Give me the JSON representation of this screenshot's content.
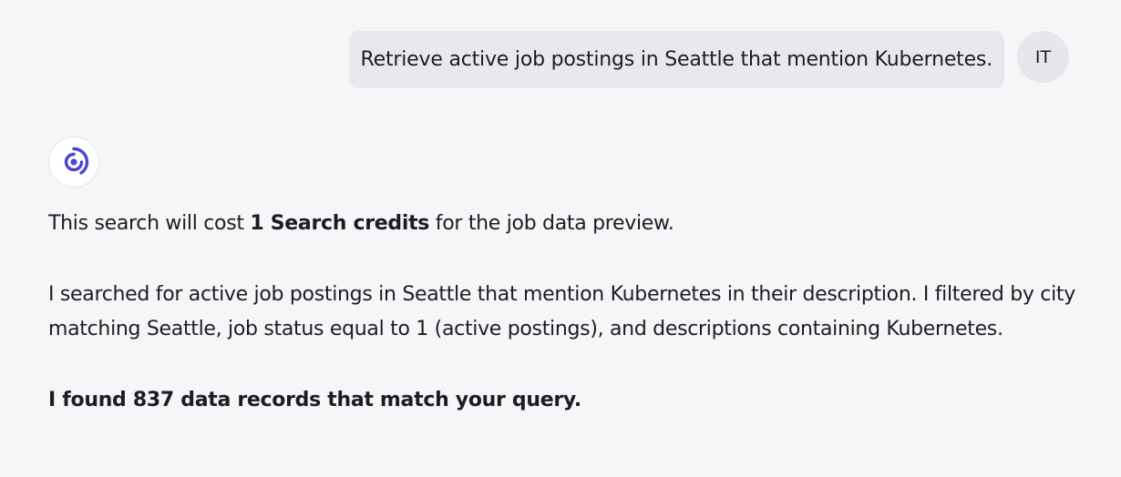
{
  "user_message": {
    "text": "Retrieve active job postings in Seattle that mention Kubernetes.",
    "avatar_initials": "IT"
  },
  "assistant": {
    "logo_icon": "assistant-logo-icon",
    "cost_prefix": "This search will cost ",
    "cost_bold": "1 Search credits",
    "cost_suffix": " for the job data preview.",
    "description": "I searched for active job postings in Seattle that mention Kubernetes in their description. I filtered by city matching Seattle, job status equal to 1 (active postings), and descriptions containing Kubernetes.",
    "result": "I found 837 data records that match your query."
  },
  "colors": {
    "background": "#f6f6f8",
    "user_bubble": "#e8e8ed",
    "logo_accent": "#4a45d6"
  }
}
